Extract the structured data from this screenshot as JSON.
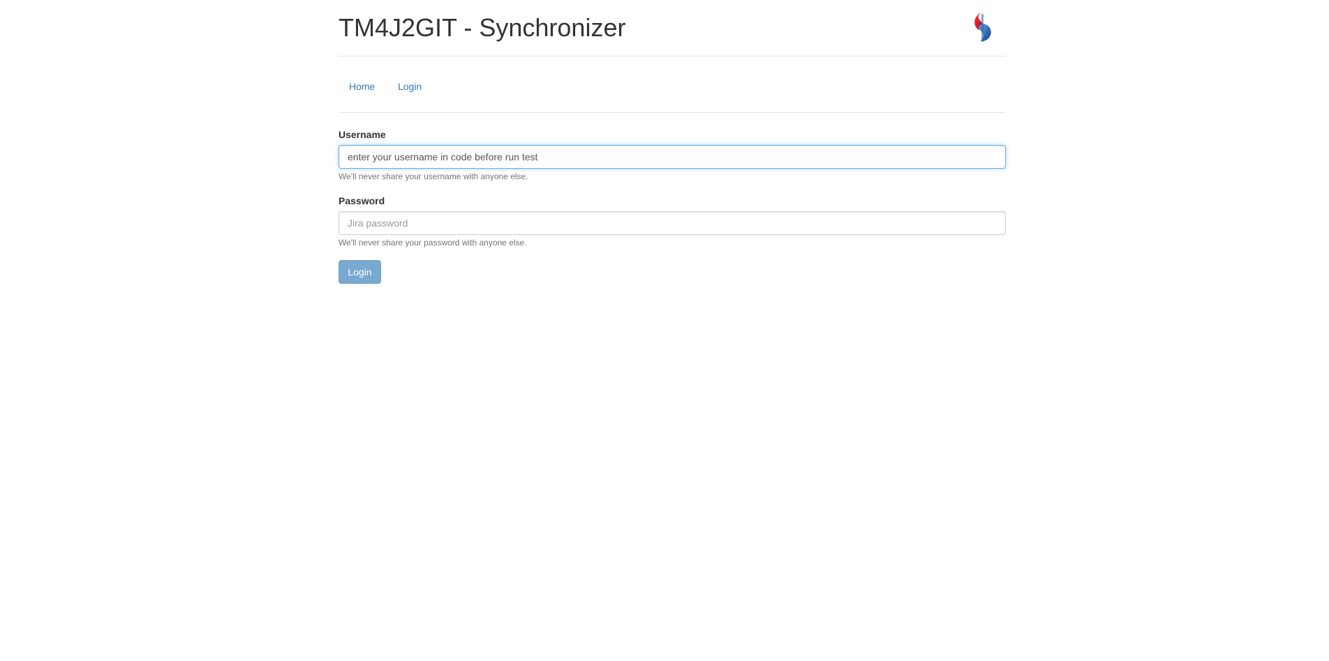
{
  "header": {
    "title": "TM4J2GIT - Synchronizer",
    "logo_icon": "swisscom-logo-icon"
  },
  "nav": {
    "items": [
      {
        "label": "Home"
      },
      {
        "label": "Login"
      }
    ]
  },
  "form": {
    "username": {
      "label": "Username",
      "value": "enter your username in code before run test",
      "placeholder": "",
      "help": "We'll never share your username with anyone else."
    },
    "password": {
      "label": "Password",
      "value": "",
      "placeholder": "Jira password",
      "help": "We'll never share your password with anyone else."
    },
    "submit_label": "Login"
  },
  "colors": {
    "link": "#337ab7",
    "primary_button": "#337ab7",
    "focus_border": "#66afe9",
    "logo_red": "#e4002b",
    "logo_blue": "#1a5fb4"
  }
}
